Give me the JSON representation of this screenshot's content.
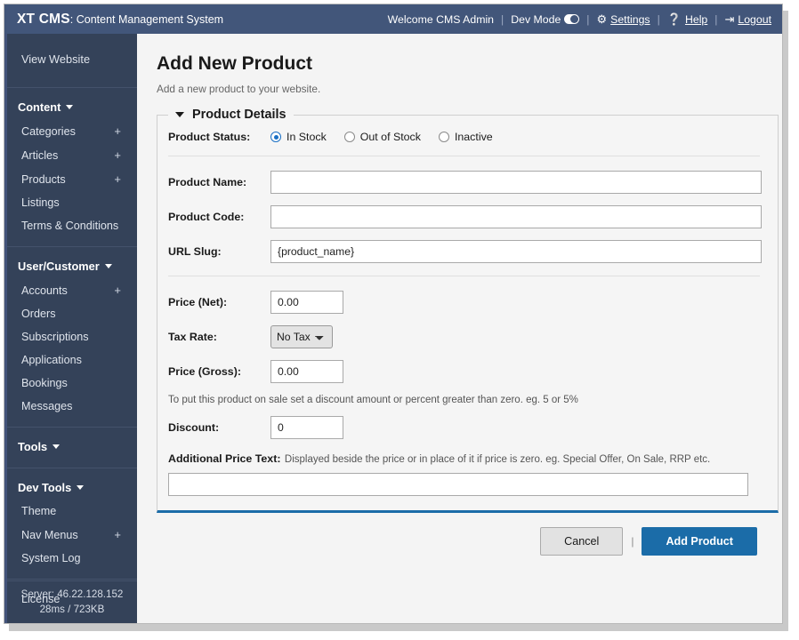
{
  "topbar": {
    "brand_strong": "XT CMS",
    "brand_rest": ": Content Management System",
    "welcome": "Welcome CMS Admin",
    "dev_mode_label": "Dev Mode",
    "settings_label": "Settings",
    "help_label": "Help",
    "logout_label": "Logout",
    "separator": "|",
    "bg_color": "#42567a"
  },
  "sidebar": {
    "bg_color": "#344259",
    "view_website": "View Website",
    "groups": [
      {
        "head": "Content",
        "items": [
          {
            "label": "Categories",
            "expand": "+"
          },
          {
            "label": "Articles",
            "expand": "+"
          },
          {
            "label": "Products",
            "expand": "+"
          },
          {
            "label": "Listings",
            "expand": ""
          },
          {
            "label": "Terms & Conditions",
            "expand": ""
          }
        ]
      },
      {
        "head": "User/Customer",
        "items": [
          {
            "label": "Accounts",
            "expand": "+"
          },
          {
            "label": "Orders",
            "expand": ""
          },
          {
            "label": "Subscriptions",
            "expand": ""
          },
          {
            "label": "Applications",
            "expand": ""
          },
          {
            "label": "Bookings",
            "expand": ""
          },
          {
            "label": "Messages",
            "expand": ""
          }
        ]
      },
      {
        "head": "Tools",
        "items": []
      },
      {
        "head": "Dev Tools",
        "items": [
          {
            "label": "Theme",
            "expand": ""
          },
          {
            "label": "Nav Menus",
            "expand": "+"
          },
          {
            "label": "System Log",
            "expand": ""
          }
        ]
      }
    ],
    "license": "License",
    "server_line1": "Server: 46.22.128.152",
    "server_line2": "28ms / 723KB"
  },
  "main": {
    "title": "Add New Product",
    "subtitle": "Add a new product to your website.",
    "panel_legend": "Product Details",
    "accent_color": "#1b6ca8",
    "fields": {
      "status_label": "Product Status:",
      "status_options": [
        {
          "label": "In Stock",
          "selected": true
        },
        {
          "label": "Out of Stock",
          "selected": false
        },
        {
          "label": "Inactive",
          "selected": false
        }
      ],
      "product_name_label": "Product Name:",
      "product_name_value": "",
      "product_code_label": "Product Code:",
      "product_code_value": "",
      "url_slug_label": "URL Slug:",
      "url_slug_value": "{product_name}",
      "price_net_label": "Price (Net):",
      "price_net_value": "0.00",
      "tax_rate_label": "Tax Rate:",
      "tax_rate_value": "No Tax",
      "tax_rate_options": [
        "No Tax"
      ],
      "price_gross_label": "Price (Gross):",
      "price_gross_value": "0.00",
      "discount_help": "To put this product on sale set a discount amount or percent greater than zero. eg. 5 or 5%",
      "discount_label": "Discount:",
      "discount_value": "0",
      "additional_price_label": "Additional Price Text:",
      "additional_price_help": "Displayed beside the price or in place of it if price is zero. eg. Special Offer, On Sale, RRP etc.",
      "additional_price_value": ""
    },
    "actions": {
      "cancel_label": "Cancel",
      "separator": "|",
      "submit_label": "Add Product"
    }
  }
}
